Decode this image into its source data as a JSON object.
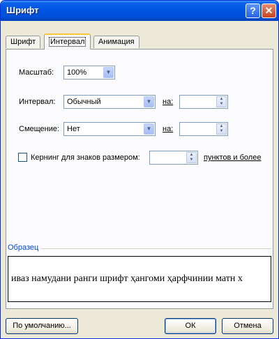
{
  "window": {
    "title": "Шрифт",
    "help_glyph": "?",
    "close_glyph": "✕"
  },
  "tabs": [
    {
      "label": "Шрифт",
      "active": false
    },
    {
      "label": "Интервал",
      "active": true
    },
    {
      "label": "Анимация",
      "active": false
    }
  ],
  "scale": {
    "label": "Масштаб:",
    "value": "100%"
  },
  "spacing": {
    "label": "Интервал:",
    "value": "Обычный",
    "by_label": "на:",
    "by_value": ""
  },
  "position": {
    "label": "Смещение:",
    "value": "Нет",
    "by_label": "на:",
    "by_value": ""
  },
  "kerning": {
    "label": "Кернинг для знаков размером:",
    "checked": false,
    "value": "",
    "suffix": "пунктов и более"
  },
  "preview": {
    "group_label": "Образец",
    "text": "иваз намудани ранги шрифт ҳангоми ҳарфчинии матн х"
  },
  "buttons": {
    "default": "По умолчанию...",
    "ok": "ОК",
    "cancel": "Отмена"
  },
  "icons": {
    "dropdown": "chevron-down-icon",
    "spin": "up-down-icon"
  },
  "colors": {
    "titlebar": "#0054e3",
    "dialog_bg": "#ece9d8",
    "group_label": "#0046d5",
    "tab_highlight": "#ffc83c"
  }
}
